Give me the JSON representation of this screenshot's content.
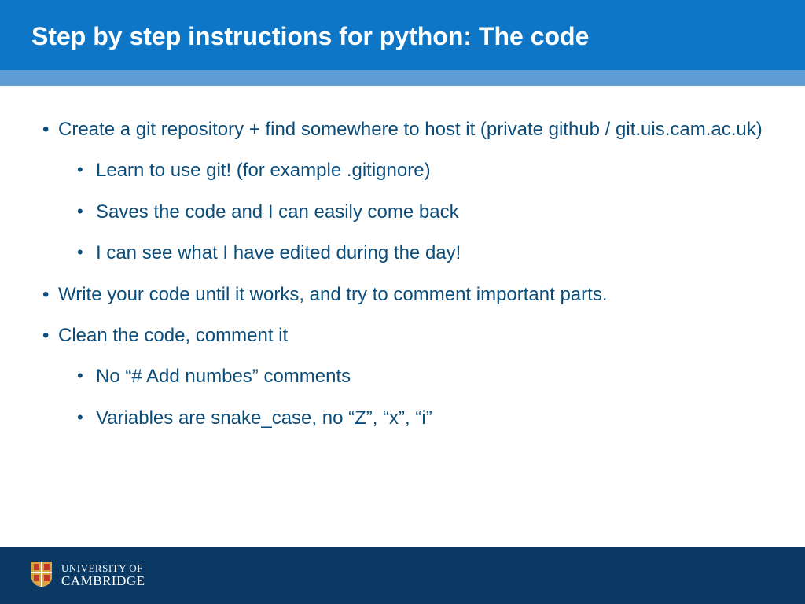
{
  "header": {
    "title": "Step by step instructions for python: The code"
  },
  "bullets": {
    "b1": "Create a git repository + find somewhere to host it (private github / git.uis.cam.ac.uk)",
    "b1_1": "Learn to use git! (for example .gitignore)",
    "b1_2": "Saves the code and I can easily come back",
    "b1_3": "I can see what I have edited during the day!",
    "b2": "Write your code until it works, and try to comment important parts.",
    "b3": "Clean the code, comment it",
    "b3_1": "No “# Add numbes” comments",
    "b3_2": "Variables are snake_case, no “Z”, “x”, “i”"
  },
  "footer": {
    "logo_line1": "UNIVERSITY OF",
    "logo_line2": "CAMBRIDGE"
  },
  "colors": {
    "header_bg": "#0d76c6",
    "accent_bg": "#5e9cd3",
    "text": "#0b4d7a",
    "footer_bg": "#0a3a63"
  }
}
